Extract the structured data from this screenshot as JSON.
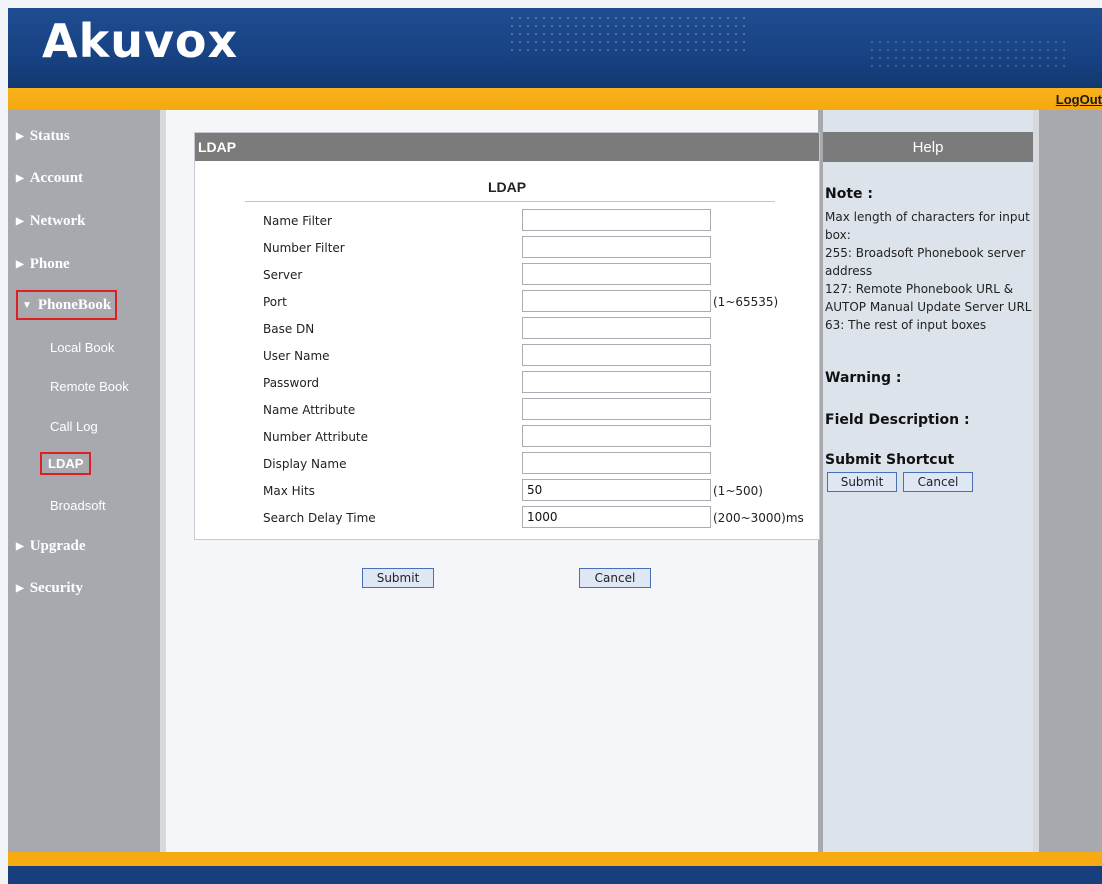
{
  "brand": {
    "logo": "Akuvox"
  },
  "header": {
    "logout": "LogOut"
  },
  "sidebar": {
    "items": [
      {
        "label": "Status"
      },
      {
        "label": "Account"
      },
      {
        "label": "Network"
      },
      {
        "label": "Phone"
      },
      {
        "label": "PhoneBook"
      },
      {
        "label": "Upgrade"
      },
      {
        "label": "Security"
      }
    ],
    "sub_items": [
      {
        "label": "Local Book"
      },
      {
        "label": "Remote Book"
      },
      {
        "label": "Call Log"
      },
      {
        "label": "LDAP"
      },
      {
        "label": "Broadsoft"
      }
    ]
  },
  "panel": {
    "title": "LDAP",
    "section_title": "LDAP",
    "fields": [
      {
        "label": "Name Filter",
        "value": "",
        "hint": ""
      },
      {
        "label": "Number Filter",
        "value": "",
        "hint": ""
      },
      {
        "label": "Server",
        "value": "",
        "hint": ""
      },
      {
        "label": "Port",
        "value": "",
        "hint": "(1~65535)"
      },
      {
        "label": "Base DN",
        "value": "",
        "hint": ""
      },
      {
        "label": "User Name",
        "value": "",
        "hint": ""
      },
      {
        "label": "Password",
        "value": "",
        "hint": ""
      },
      {
        "label": "Name Attribute",
        "value": "",
        "hint": ""
      },
      {
        "label": "Number Attribute",
        "value": "",
        "hint": ""
      },
      {
        "label": "Display Name",
        "value": "",
        "hint": ""
      },
      {
        "label": "Max Hits",
        "value": "50",
        "hint": "(1~500)"
      },
      {
        "label": "Search Delay Time",
        "value": "1000",
        "hint": "(200~3000)ms"
      }
    ],
    "submit_label": "Submit",
    "cancel_label": "Cancel"
  },
  "help": {
    "title": "Help",
    "note_heading": "Note :",
    "note_lines": [
      "Max length of characters for input box:",
      "255: Broadsoft Phonebook server address",
      "127: Remote Phonebook URL & AUTOP Manual Update Server URL",
      "63: The rest of input boxes"
    ],
    "warning_heading": "Warning :",
    "field_desc_heading": "Field Description :",
    "shortcut_heading": "Submit Shortcut",
    "shortcut_submit": "Submit",
    "shortcut_cancel": "Cancel"
  },
  "colors": {
    "header_blue": "#184385",
    "orange_bar": "#f6a80f",
    "sidebar_gray": "#a7a9ae",
    "panel_title_gray": "#7b7b7b",
    "active_border_red": "#e02020"
  }
}
